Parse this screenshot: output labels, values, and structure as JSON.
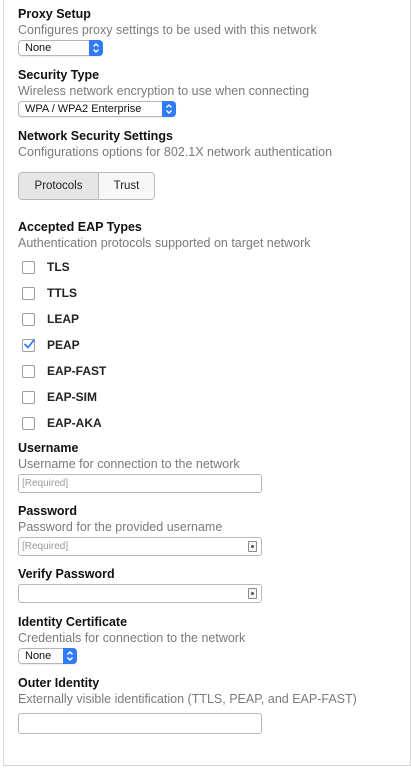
{
  "proxy": {
    "label": "Proxy Setup",
    "description": "Configures proxy settings to be used with this network",
    "value": "None"
  },
  "security_type": {
    "label": "Security Type",
    "description": "Wireless network encryption to use when connecting",
    "value": "WPA / WPA2 Enterprise"
  },
  "network_security": {
    "label": "Network Security Settings",
    "description": "Configurations options for 802.1X network authentication",
    "tabs": [
      "Protocols",
      "Trust"
    ],
    "active_tab": "Protocols"
  },
  "eap": {
    "label": "Accepted EAP Types",
    "description": "Authentication protocols supported on target network",
    "types": [
      {
        "label": "TLS",
        "checked": false
      },
      {
        "label": "TTLS",
        "checked": false
      },
      {
        "label": "LEAP",
        "checked": false
      },
      {
        "label": "PEAP",
        "checked": true
      },
      {
        "label": "EAP-FAST",
        "checked": false
      },
      {
        "label": "EAP-SIM",
        "checked": false
      },
      {
        "label": "EAP-AKA",
        "checked": false
      }
    ]
  },
  "username": {
    "label": "Username",
    "description": "Username for connection to the network",
    "placeholder": "[Required]"
  },
  "password": {
    "label": "Password",
    "description": "Password for the provided username",
    "placeholder": "[Required]"
  },
  "verify_password": {
    "label": "Verify Password"
  },
  "identity_certificate": {
    "label": "Identity Certificate",
    "description": "Credentials for connection to the network",
    "value": "None"
  },
  "outer_identity": {
    "label": "Outer Identity",
    "description": "Externally visible identification (TTLS, PEAP, and EAP-FAST)"
  },
  "colors": {
    "accent": "#2f7cf6",
    "muted_text": "#7a7a7a"
  }
}
